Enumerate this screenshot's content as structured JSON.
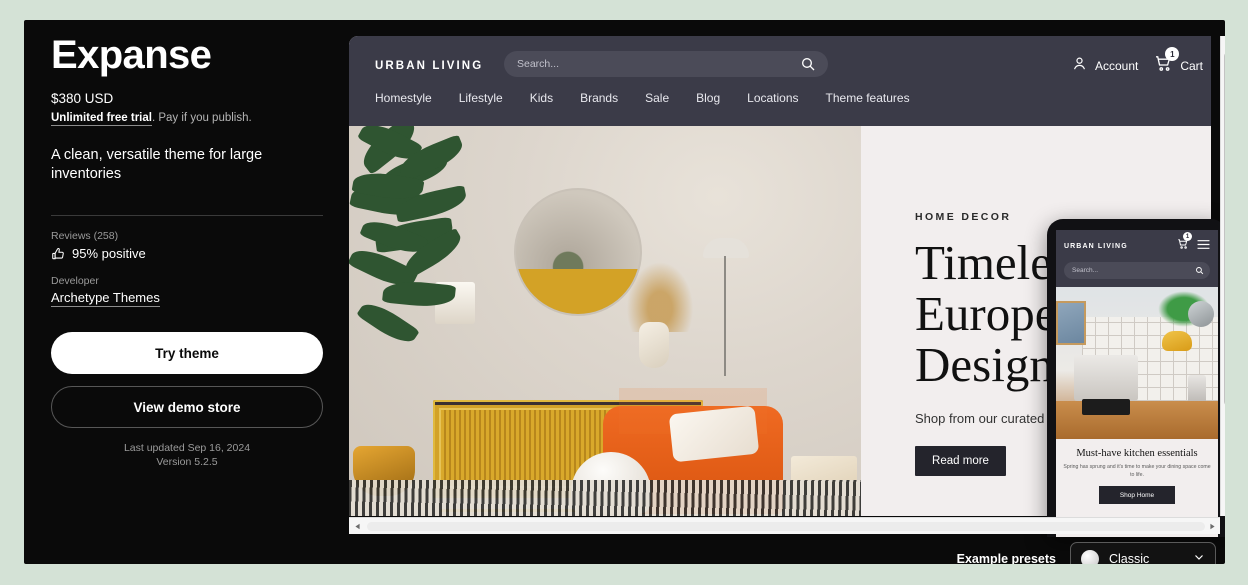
{
  "page": {
    "background_color": "#d4e2d6",
    "card_background": "#0a0a0a"
  },
  "theme_info": {
    "title": "Expanse",
    "price": "$380 USD",
    "trial_strong": "Unlimited free trial",
    "trial_rest": ". Pay if you publish.",
    "tagline": "A clean, versatile theme for large inventories",
    "reviews_label": "Reviews (258)",
    "reviews_value": "95% positive",
    "reviews_icon": "thumbs-up-icon",
    "developer_label": "Developer",
    "developer_name": "Archetype Themes",
    "try_theme_label": "Try theme",
    "view_demo_label": "View demo store",
    "last_updated": "Last updated Sep 16, 2024",
    "version": "Version 5.2.5"
  },
  "preview": {
    "store": {
      "brand": "URBAN LIVING",
      "search_placeholder": "Search...",
      "search_icon": "magnifier-icon",
      "account_label": "Account",
      "account_icon": "person-icon",
      "cart_label": "Cart",
      "cart_icon": "shopping-cart-icon",
      "cart_count": "1",
      "nav": [
        "Homestyle",
        "Lifestyle",
        "Kids",
        "Brands",
        "Sale",
        "Blog",
        "Locations",
        "Theme features"
      ]
    },
    "hero": {
      "eyebrow": "HOME DECOR",
      "title_line1": "Timeless",
      "title_line2": "European",
      "title_line3": "Design",
      "subtitle": "Shop from our curated brands.",
      "cta_label": "Read more",
      "image_alt": "living-room-interior-photo"
    },
    "mobile": {
      "brand": "URBAN LIVING",
      "search_placeholder": "Search...",
      "search_icon": "magnifier-icon",
      "cart_icon": "shopping-cart-icon",
      "cart_count": "1",
      "menu_icon": "hamburger-menu-icon",
      "caption_title": "Must-have kitchen essentials",
      "caption_sub": "Spring has sprung and it's time to make your dining space come to life.",
      "cta_label": "Shop Home",
      "image_alt": "kitchen-counter-photo",
      "prev_icon": "chevron-left-icon",
      "next_icon": "chevron-right-icon"
    }
  },
  "scrollbars": {
    "vertical": {
      "up_icon": "caret-up-icon",
      "down_icon": "caret-down-icon"
    },
    "horizontal": {
      "left_icon": "caret-left-icon",
      "right_icon": "caret-right-icon"
    }
  },
  "bottom_bar": {
    "presets_label": "Example presets",
    "selected_preset": "Classic",
    "swatch_color": "#e4e4e4",
    "chevron_icon": "chevron-down-icon"
  }
}
